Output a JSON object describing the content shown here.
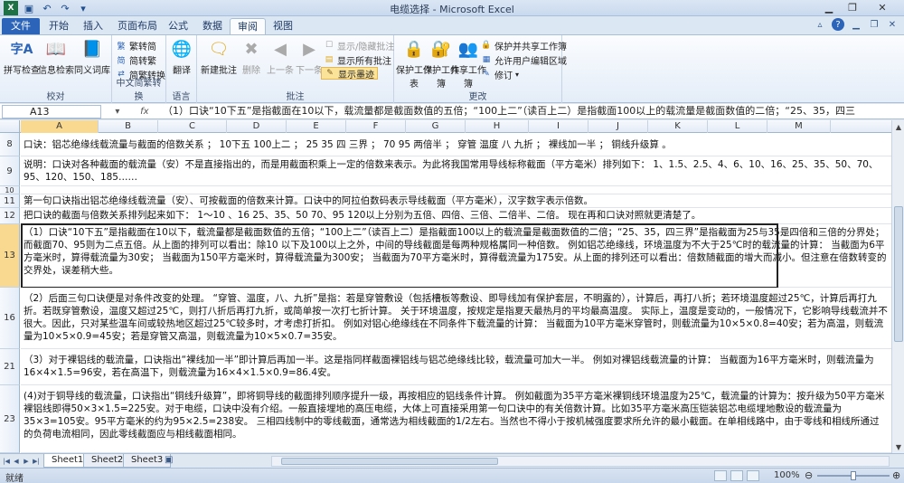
{
  "window": {
    "title": "电缆选择 - Microsoft Excel"
  },
  "tabs": [
    {
      "label": "文件",
      "type": "file"
    },
    {
      "label": "开始"
    },
    {
      "label": "插入"
    },
    {
      "label": "页面布局"
    },
    {
      "label": "公式"
    },
    {
      "label": "数据"
    },
    {
      "label": "审阅",
      "active": true
    },
    {
      "label": "视图"
    }
  ],
  "ribbon": {
    "proofing": {
      "label": "校对",
      "spell_check": "拼写检查",
      "research": "信息检索",
      "thesaurus": "同义词库"
    },
    "chinese_conversion": {
      "label": "中文简繁转换",
      "to_simplified": "繁转简",
      "to_traditional": "简转繁",
      "convert": "简繁转换"
    },
    "language": {
      "label": "语言",
      "translate": "翻译"
    },
    "comments": {
      "label": "批注",
      "new_comment": "新建批注",
      "delete": "删除",
      "previous": "上一条",
      "next": "下一条",
      "show_hide": "显示/隐藏批注",
      "show_all": "显示所有批注",
      "show_ink": "显示墨迹"
    },
    "changes": {
      "label": "更改",
      "protect_sheet": "保护工作表",
      "protect_workbook": "保护工作簿",
      "share_workbook": "共享工作簿",
      "protect_and_share": "保护并共享工作簿",
      "allow_edit_ranges": "允许用户编辑区域",
      "track_changes": "修订"
    }
  },
  "formula_bar": {
    "name_box": "A13",
    "formula": "（1）口诀“10下五”是指截面在10以下，载流量都是截面数值的五倍；“100上二”（读百上二）是指截面100以上的载流量是截面数值的二倍；“25、35，四三"
  },
  "grid": {
    "columns": [
      "A",
      "B",
      "C",
      "D",
      "E",
      "F",
      "G",
      "H",
      "I",
      "J",
      "K",
      "L",
      "M"
    ],
    "rows": [
      {
        "num": "8",
        "text": "口诀：铝芯绝缘线载流量与截面的倍数关系  ；  10下五  100上二  ；  25  35  四  三界  ；  70  95  两倍半  ；  穿管  温度  八  九折  ；  裸线加一半  ；  铜线升级算  。"
      },
      {
        "num": "9",
        "text": "说明：口诀对各种截面的载流量（安）不是直接指出的，而是用截面积乘上一定的倍数来表示。为此将我国常用导线标称截面（平方毫米）排列如下：  1、1.5、2.5、4、6、10、16、25、35、50、70、95、120、150、185……"
      },
      {
        "num": "10",
        "text": ""
      },
      {
        "num": "11",
        "text": "第一句口诀指出铝芯绝缘线载流量（安）、可按截面的倍数来计算。口诀中的阿拉伯数码表示导线截面（平方毫米），汉字数字表示倍数。"
      },
      {
        "num": "12",
        "text": "把口诀的截面与倍数关系排列起来如下：  1～10  、16  25、35、50  70、95   120以上分别为五倍、四倍、三倍、二倍半、二倍。  现在再和口诀对照就更清楚了。"
      },
      {
        "num": "13",
        "text": "（1）口诀“10下五”是指截面在10以下，载流量都是截面数值的五倍；“100上二”（读百上二）是指截面100以上的载流量是截面数值的二倍；“25、35，四三界”是指截面为25与35是四倍和三倍的分界处；而截面70、95则为二点五倍。从上面的排列可以看出：除10 以下及100以上之外，中间的导线截面是每两种规格属同一种倍数。  例如铝芯绝缘线，环境温度为不大于25℃时的载流量的计算：  当截面为6平方毫米时，算得载流量为30安；  当截面为150平方毫米时，算得载流量为300安；  当截面为70平方毫米时，算得载流量为175安。从上面的排列还可以看出：倍数随截面的增大而减小。但注意在倍数转变的交界处，误差稍大些。"
      },
      {
        "num": "16",
        "text": "（2）后面三句口诀便是对条件改变的处理。  “穿管、温度，八、九折”是指：若是穿管敷设（包括槽板等敷设、即导线加有保护套层，不明露的），计算后，再打八折；若环境温度超过25℃，计算后再打九折。若既穿管敷设，温度又超过25℃，则打八折后再打九折，或简单按一次打七折计算。  关于环境温度，按规定是指夏天最热月的平均最高温度。  实际上，温度是变动的，一般情况下，它影响导线载流并不很大。因此，只对某些温车间或较热地区超过25℃较多时，才考虑打折扣。   例如对铝心绝缘线在不同条件下载流量的计算：  当截面为10平方毫米穿管时，则载流量为10×5×0.8=40安；若为高温，则载流量为10×5×0.9=45安；若是穿管又高温，则载流量为10×5×0.7=35安。"
      },
      {
        "num": "21",
        "text": "（3）对于裸铝线的载流量，口诀指出“裸线加一半”即计算后再加一半。这是指同样截面裸铝线与铝芯绝缘线比较，载流量可加大一半。  例如对裸铝线载流量的计算：  当截面为16平方毫米时，则载流量为16×4×1.5=96安，若在高温下，则载流量为16×4×1.5×0.9=86.4安。"
      },
      {
        "num": "23",
        "text": "(4)对于铜导线的载流量，口诀指出“铜线升级算”，即将铜导线的截面排列顺序提升一级，再按相应的铝线条件计算。  例如截面为35平方毫米裸铜线环境温度为25℃，载流量的计算为：按升级为50平方毫米裸铝线即得50×3×1.5=225安。对于电缆，口诀中没有介绍。一般直接埋地的高压电缆，大体上可直接采用第一句口诀中的有关倍数计算。比如35平方毫米高压铠装铝芯电缆埋地敷设的载流量为35×3=105安。95平方毫米的约为95×2.5=238安。  三相四线制中的零线截面，通常选为相线截面的1/2左右。当然也不得小于按机械强度要求所允许的最小截面。在单相线路中，由于零线和相线所通过的负荷电流相同，因此零线截面应与相线截面相同。"
      }
    ]
  },
  "sheets": [
    {
      "name": "Sheet1",
      "active": true
    },
    {
      "name": "Sheet2"
    },
    {
      "name": "Sheet3"
    }
  ],
  "status": {
    "mode": "就绪",
    "zoom": "100%",
    "zoom_fraction": 0.5
  },
  "colors": {
    "file_tab": "#2b64b8",
    "selection_header": "#f8d98f",
    "highlight_button": "#fbe49a"
  }
}
